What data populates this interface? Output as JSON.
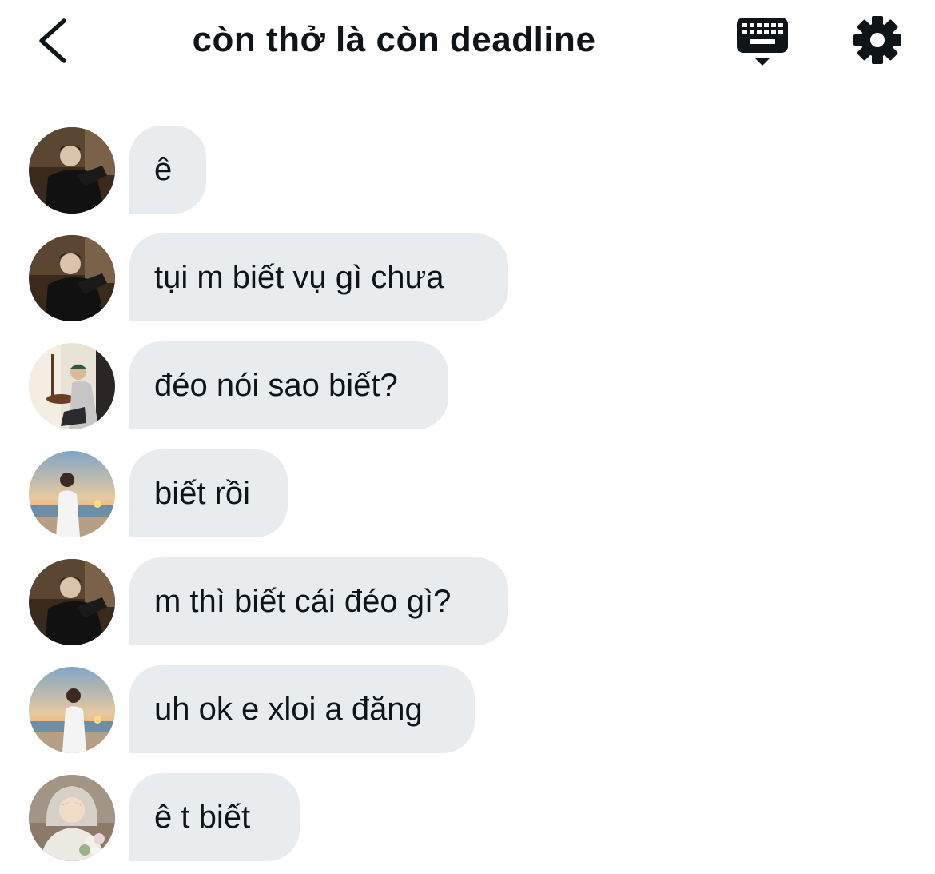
{
  "header": {
    "title": "còn thở là còn deadline",
    "back_icon": "chevron-left-icon",
    "keyboard_icon": "keyboard-icon",
    "settings_icon": "gear-icon"
  },
  "colors": {
    "bubble_bg": "#e8ecef",
    "text": "#0f1419",
    "background": "#ffffff"
  },
  "messages": [
    {
      "avatar": "avatar-dark-jacket",
      "text": "ê"
    },
    {
      "avatar": "avatar-dark-jacket",
      "text": "tụi m biết vụ gì chưa"
    },
    {
      "avatar": "avatar-room-cap",
      "text": "đéo nói sao biết?"
    },
    {
      "avatar": "avatar-beach-sunset",
      "text": "biết rồi"
    },
    {
      "avatar": "avatar-dark-jacket",
      "text": "m thì biết cái đéo gì?"
    },
    {
      "avatar": "avatar-beach-sunset",
      "text": "uh ok e xloi a đăng"
    },
    {
      "avatar": "avatar-hood-flowers",
      "text": "ê t biết"
    }
  ]
}
